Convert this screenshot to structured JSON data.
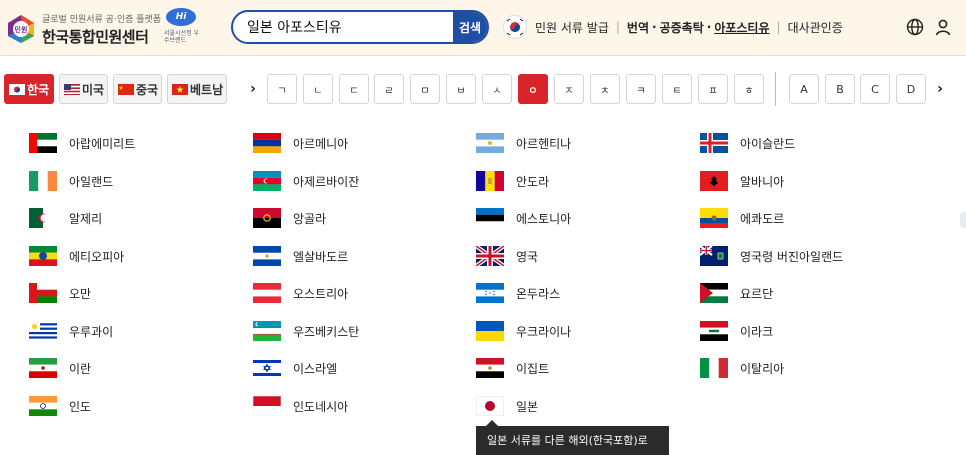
{
  "header": {
    "logo_sub": "글로벌 민원서류 공·인증 플랫폼",
    "logo_main": "한국통합민원센터",
    "logo_mark_text": "민원",
    "hiseoul_badge": "Hi Seoul",
    "hiseoul_caption": "서울시선정 우수브랜드",
    "search_value": "일본 아포스티유",
    "search_button": "검색",
    "utility": {
      "issue": "민원 서류 발급",
      "translation": "번역",
      "notary": "공증촉탁",
      "apostille": "아포스티유",
      "embassy": "대사관인증"
    }
  },
  "languages": [
    {
      "label": "한국",
      "flag": "kr"
    },
    {
      "label": "미국",
      "flag": "us"
    },
    {
      "label": "중국",
      "flag": "cn"
    },
    {
      "label": "베트남",
      "flag": "vn"
    }
  ],
  "jamo": [
    "ㄱ",
    "ㄴ",
    "ㄷ",
    "ㄹ",
    "ㅁ",
    "ㅂ",
    "ㅅ",
    "ㅇ",
    "ㅈ",
    "ㅊ",
    "ㅋ",
    "ㅌ",
    "ㅍ",
    "ㅎ"
  ],
  "latin": [
    "A",
    "B",
    "C",
    "D"
  ],
  "countries": [
    [
      "아랍에미리트",
      "아르메니아",
      "아르헨티나",
      "아이슬란드"
    ],
    [
      "아일랜드",
      "아제르바이잔",
      "안도라",
      "알바니아"
    ],
    [
      "알제리",
      "앙골라",
      "에스토니아",
      "에콰도르"
    ],
    [
      "에티오피아",
      "엘살바도르",
      "영국",
      "영국령 버진아일랜드"
    ],
    [
      "오만",
      "오스트리아",
      "온두라스",
      "요르단"
    ],
    [
      "우루과이",
      "우즈베키스탄",
      "우크라이나",
      "이라크"
    ],
    [
      "이란",
      "이스라엘",
      "이집트",
      "이탈리아"
    ],
    [
      "인도",
      "인도네시아",
      "일본"
    ]
  ],
  "tooltip": "일본 서류를 다른 해외(한국포함)로",
  "colors": {
    "accent_red": "#d9252a",
    "navy": "#1f4fa3",
    "header_bg": "#fff6ea"
  }
}
